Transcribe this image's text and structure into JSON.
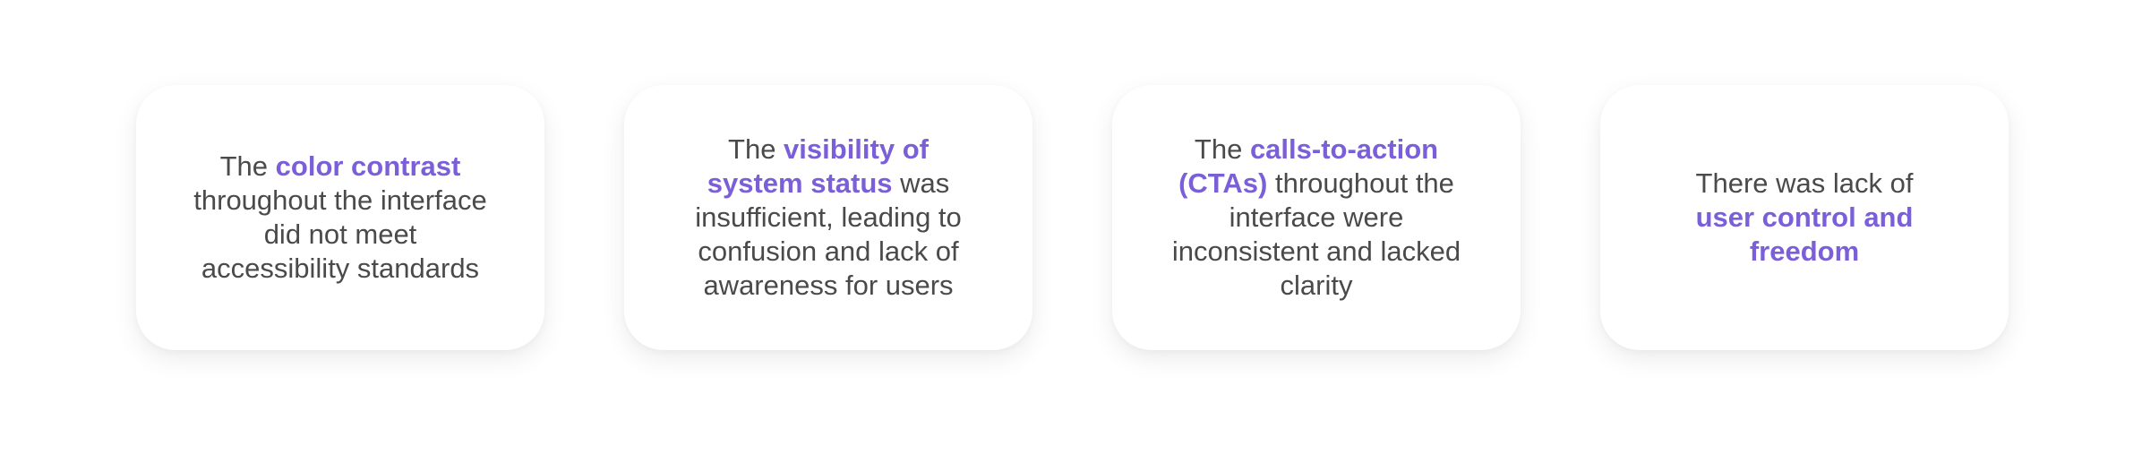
{
  "cards": [
    {
      "before": "The ",
      "highlight": "color contrast",
      "after": " throughout the interface did not meet accessibility standards"
    },
    {
      "before": "The ",
      "highlight": "visibility of system status",
      "after": " was insufficient, leading to confusion and lack of awareness for users"
    },
    {
      "before": "The ",
      "highlight": "calls-to-action (CTAs)",
      "after": " throughout the interface were inconsistent and lacked clarity"
    },
    {
      "before": "There was lack of ",
      "highlight": "user control and freedom",
      "after": ""
    }
  ],
  "colors": {
    "highlight": "#7b5fd9",
    "text": "#4a4a4a",
    "background": "#ffffff"
  }
}
